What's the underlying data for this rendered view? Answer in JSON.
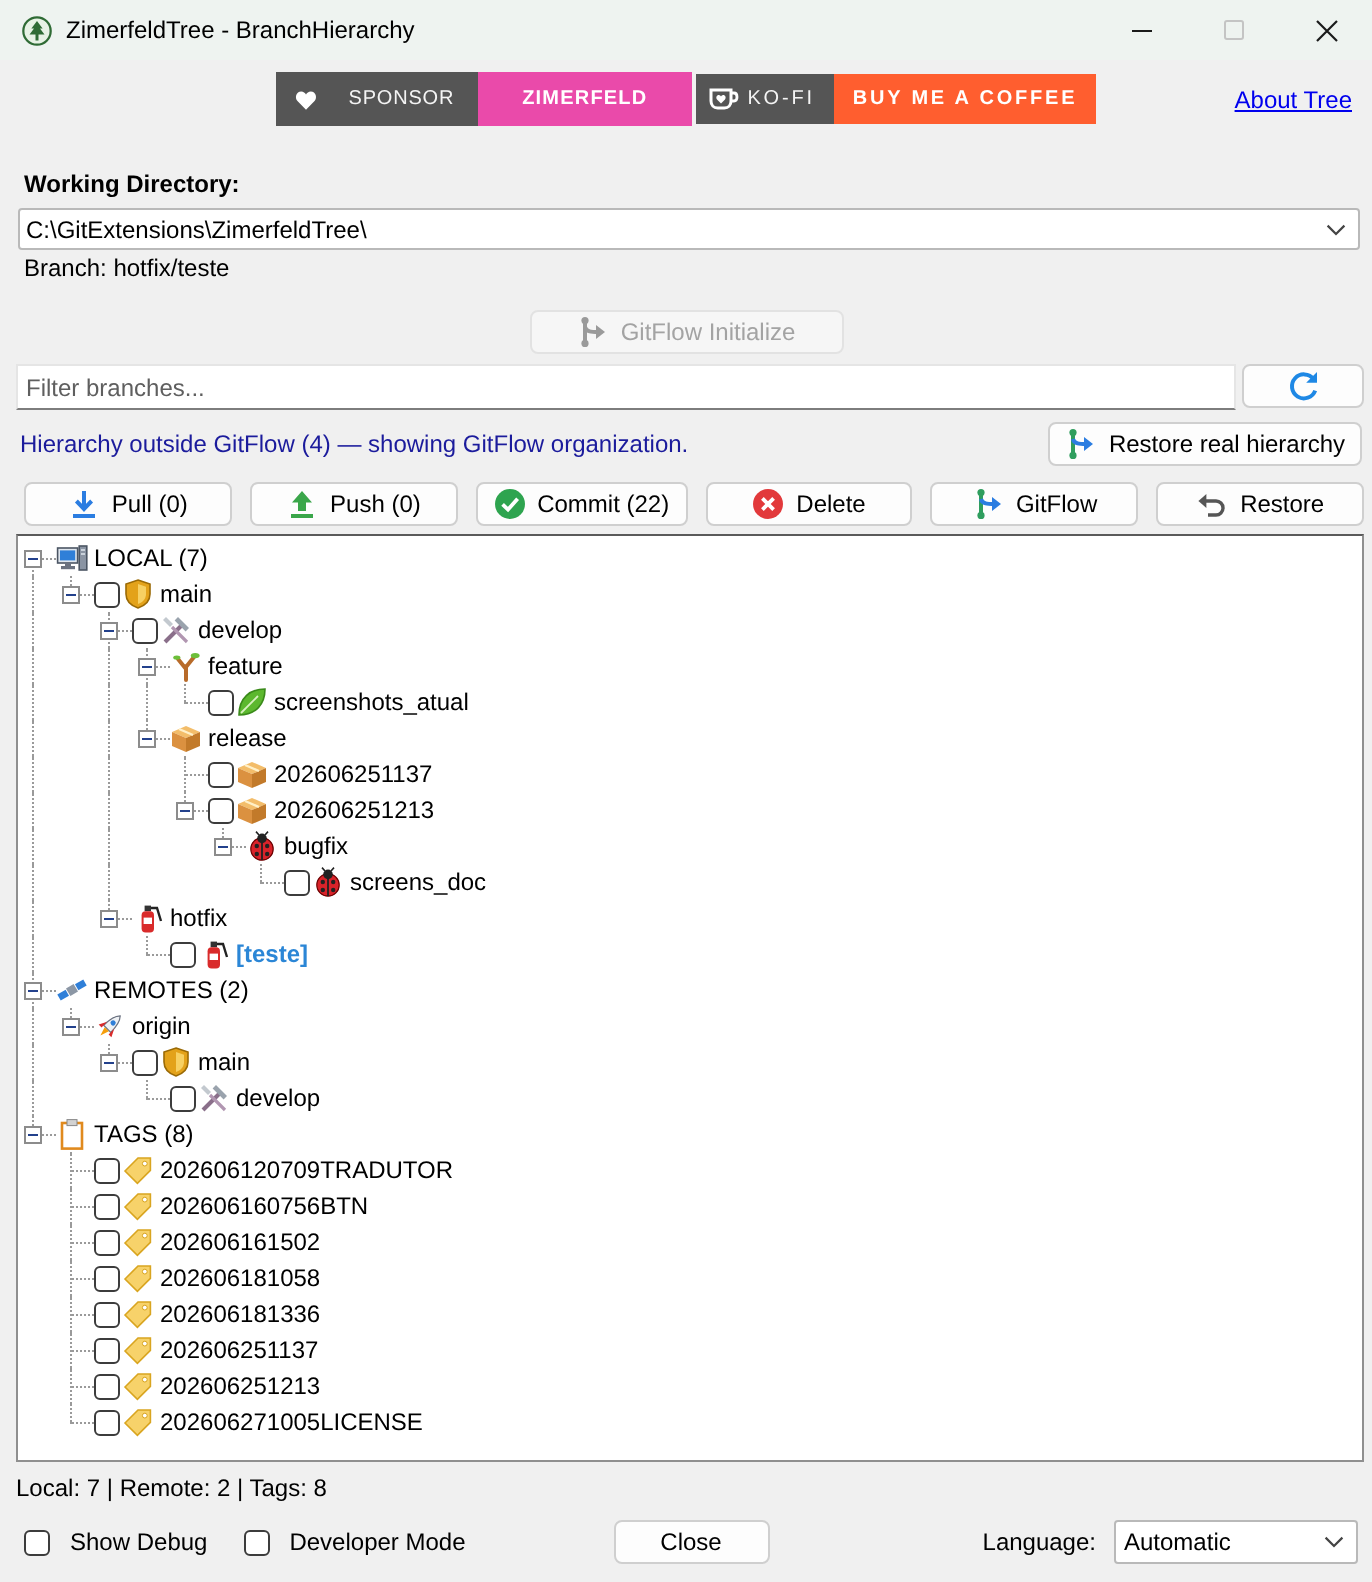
{
  "window": {
    "title": "ZimerfeldTree - BranchHierarchy",
    "controls": [
      {
        "kind": "minimize",
        "disabled": false
      },
      {
        "kind": "maximize",
        "disabled": true
      },
      {
        "kind": "close",
        "disabled": false
      }
    ]
  },
  "badges": [
    {
      "kind": "sponsor",
      "label": "SPONSOR",
      "value": "ZIMERFELD",
      "color": "#ea4aaa"
    },
    {
      "kind": "kofi",
      "label": "KO-FI",
      "value": "BUY ME A COFFEE",
      "color": "#ff5e2f"
    }
  ],
  "about_link": "About Tree",
  "working_directory": {
    "label": "Working Directory:",
    "value": "C:\\GitExtensions\\ZimerfeldTree\\"
  },
  "branch_info": "Branch: hotfix/teste",
  "gitflow_initialize": {
    "label": "GitFlow Initialize",
    "disabled": true
  },
  "filter": {
    "placeholder": "Filter branches..."
  },
  "notice": "Hierarchy outside GitFlow (4) — showing GitFlow organization.",
  "restore_hierarchy": {
    "label": "Restore real hierarchy"
  },
  "actions": [
    {
      "kind": "pull",
      "label": "Pull (0)"
    },
    {
      "kind": "push",
      "label": "Push (0)"
    },
    {
      "kind": "commit",
      "label": "Commit (22)"
    },
    {
      "kind": "delete",
      "label": "Delete"
    },
    {
      "kind": "gitflow",
      "label": "GitFlow"
    },
    {
      "kind": "restore",
      "label": "Restore"
    }
  ],
  "tree": [
    {
      "kind": "local",
      "label": "LOCAL (7)",
      "expanded": true,
      "children": [
        {
          "kind": "main",
          "label": "main",
          "checked": false,
          "current": false,
          "expanded": true,
          "children": [
            {
              "kind": "develop",
              "label": "develop",
              "checked": false,
              "current": false,
              "expanded": true,
              "children": [
                {
                  "kind": "features",
                  "label": "feature",
                  "expanded": true,
                  "children": [
                    {
                      "kind": "feature",
                      "label": "screenshots_atual",
                      "checked": false,
                      "current": false
                    }
                  ]
                },
                {
                  "kind": "releases",
                  "label": "release",
                  "expanded": true,
                  "children": [
                    {
                      "kind": "release",
                      "label": "202606251137",
                      "checked": false,
                      "current": false
                    },
                    {
                      "kind": "release",
                      "label": "202606251213",
                      "checked": false,
                      "current": false,
                      "expanded": true,
                      "children": [
                        {
                          "kind": "bugfixes",
                          "label": "bugfix",
                          "expanded": true,
                          "children": [
                            {
                              "kind": "bugfix",
                              "label": "screens_doc",
                              "checked": false,
                              "current": false
                            }
                          ]
                        }
                      ]
                    }
                  ]
                }
              ]
            },
            {
              "kind": "hotfixes",
              "label": "hotfix",
              "expanded": true,
              "children": [
                {
                  "kind": "hotfix",
                  "label": "[teste]",
                  "checked": false,
                  "current": true
                }
              ]
            }
          ]
        }
      ]
    },
    {
      "kind": "remotes",
      "label": "REMOTES (2)",
      "expanded": true,
      "children": [
        {
          "kind": "remote",
          "label": "origin",
          "expanded": true,
          "children": [
            {
              "kind": "main",
              "label": "main",
              "checked": false,
              "current": false,
              "expanded": true,
              "children": [
                {
                  "kind": "develop",
                  "label": "develop",
                  "checked": false,
                  "current": false
                }
              ]
            }
          ]
        }
      ]
    },
    {
      "kind": "tags",
      "label": "TAGS (8)",
      "expanded": true,
      "children": [
        {
          "kind": "tag",
          "label": "202606120709TRADUTOR",
          "checked": false,
          "current": false
        },
        {
          "kind": "tag",
          "label": "202606160756BTN",
          "checked": false,
          "current": false
        },
        {
          "kind": "tag",
          "label": "202606161502",
          "checked": false,
          "current": false
        },
        {
          "kind": "tag",
          "label": "202606181058",
          "checked": false,
          "current": false
        },
        {
          "kind": "tag",
          "label": "202606181336",
          "checked": false,
          "current": false
        },
        {
          "kind": "tag",
          "label": "202606251137",
          "checked": false,
          "current": false
        },
        {
          "kind": "tag",
          "label": "202606251213",
          "checked": false,
          "current": false
        },
        {
          "kind": "tag",
          "label": "202606271005LICENSE",
          "checked": false,
          "current": false
        }
      ]
    }
  ],
  "status_bar": "Local: 7 | Remote: 2 | Tags: 8",
  "footer": {
    "options": [
      {
        "label": "Show Debug",
        "checked": false
      },
      {
        "label": "Developer Mode",
        "checked": false
      }
    ],
    "close_button": "Close",
    "language": {
      "label": "Language:",
      "value": "Automatic"
    }
  }
}
